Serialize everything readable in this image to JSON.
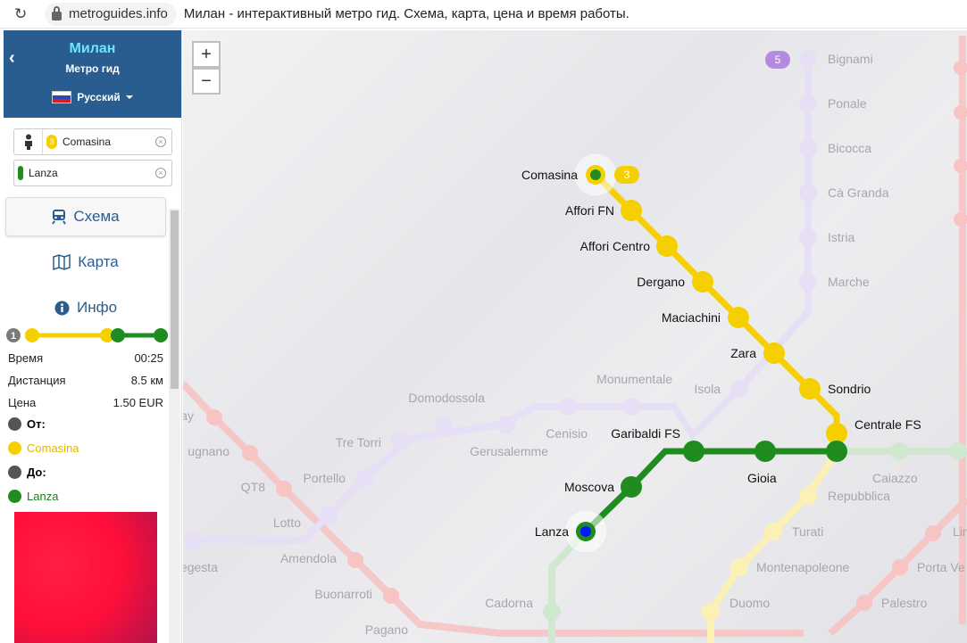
{
  "browser": {
    "domain": "metroguides.info",
    "title": "Милан - интерактивный метро гид. Схема, карта, цена и время работы."
  },
  "sidebar": {
    "city": "Милан",
    "subtitle": "Метро гид",
    "language": "Русский",
    "from_field": {
      "badge": "3",
      "value": "Comasina"
    },
    "to_field": {
      "value": "Lanza"
    },
    "tabs": [
      {
        "label": "Схема",
        "icon": "train-icon",
        "active": true
      },
      {
        "label": "Карта",
        "icon": "map-icon",
        "active": false
      },
      {
        "label": "Инфо",
        "icon": "info-icon",
        "active": false
      }
    ],
    "transfers": "1",
    "info": [
      {
        "label": "Время",
        "value": "00:25"
      },
      {
        "label": "Дистанция",
        "value": "8.5 км"
      },
      {
        "label": "Цена",
        "value": "1.50 EUR"
      }
    ],
    "from_label": "От:",
    "from_station": "Comasina",
    "to_label": "До:",
    "to_station": "Lanza",
    "colors": {
      "line3": "#f5d000",
      "line2": "#1f8c1f",
      "header": "#2a5d8f"
    }
  },
  "map": {
    "zoom_in": "+",
    "zoom_out": "−",
    "route_line_badge": "3",
    "line5_badge": "5",
    "route_stations": [
      "Comasina",
      "Affori FN",
      "Affori Centro",
      "Dergano",
      "Maciachini",
      "Zara",
      "Sondrio",
      "Centrale FS",
      "Gioia",
      "Garibaldi FS",
      "Moscova",
      "Lanza"
    ],
    "faded_stations": [
      "Bignami",
      "Ponale",
      "Bicocca",
      "Cà Granda",
      "Istria",
      "Marche",
      "Isola",
      "Monumentale",
      "Domodossola",
      "Tre Torri",
      "Gerusalemme",
      "Cenisio",
      "Portello",
      "QT8",
      "Lotto",
      "Amendola",
      "Buonarroti",
      "Pagano",
      "Cadorna",
      "Duomo",
      "Montenapoleone",
      "Turati",
      "Repubblica",
      "Caiazzo",
      "Palestro",
      "Porta Ve",
      "Lin",
      "egesta",
      "ugnano",
      "ay"
    ]
  }
}
